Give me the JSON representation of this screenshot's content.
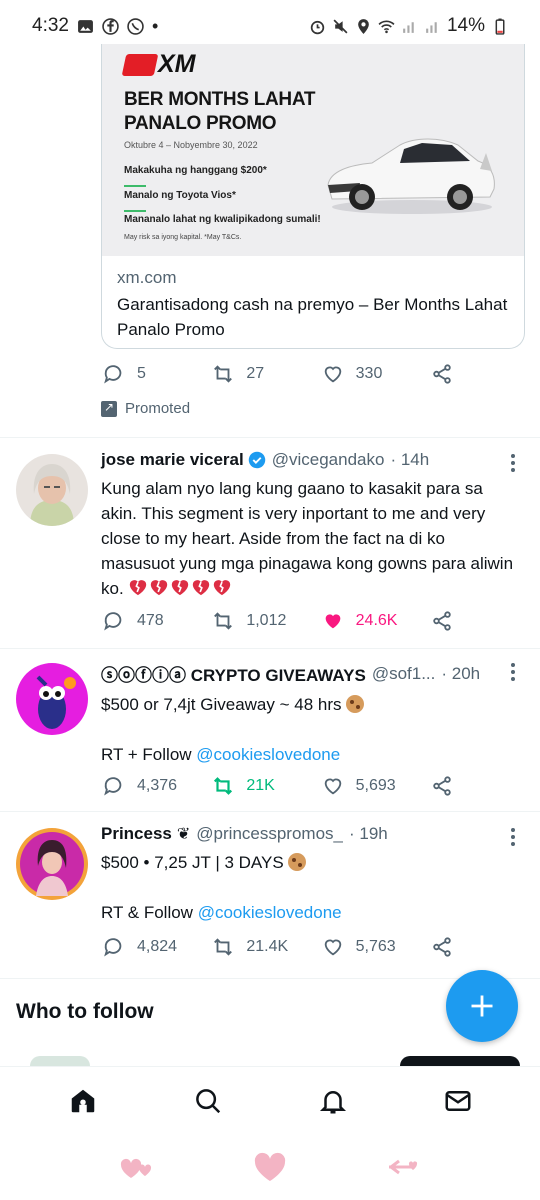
{
  "status_bar": {
    "time": "4:32",
    "battery": "14%"
  },
  "ad": {
    "image": {
      "brand": "XM",
      "title": "BER MONTHS LAHAT PANALO PROMO",
      "dates": "Oktubre 4 – Nobyembre 30, 2022",
      "line1": "Makakuha ng hanggang $200*",
      "line2": "Manalo ng Toyota Vios*",
      "line3": "Mananalo lahat ng kwalipikadong sumali!",
      "fine": "May risk sa iyong kapital. *May T&Cs."
    },
    "domain": "xm.com",
    "headline": "Garantisadong cash na premyo – Ber Months Lahat Panalo Promo",
    "replies": "5",
    "retweets": "27",
    "likes": "330",
    "promoted_label": "Promoted"
  },
  "tweets": [
    {
      "name": "jose marie viceral",
      "handle": "@vicegandako",
      "time": "· 14h",
      "text": "Kung alam nyo lang kung gaano to kasakit para sa akin. This segment is very inportant to me and very close to my heart. Aside from the fact na di ko masusuot yung mga pinagawa kong gowns para aliwin ko.",
      "replies": "478",
      "retweets": "1,012",
      "likes": "24.6K",
      "accent_color": "#f91880"
    },
    {
      "name": "ⓢⓞⓕⓘⓐ CRYPTO GIVEAWAYS",
      "handle": "@sof1...",
      "time": "· 20h",
      "line1": "$500 or 7,4jt Giveaway ~ 48 hrs",
      "line2_prefix": "RT + Follow",
      "line2_link": "@cookieslovedone",
      "replies": "4,376",
      "retweets": "21K",
      "likes": "5,693",
      "accent_color": "#00ba7c"
    },
    {
      "name": "Princess",
      "handle": "@princesspromos_",
      "time": "· 19h",
      "line1": "$500 • 7,25 JT | 3 DAYS",
      "line2_prefix": "RT & Follow",
      "line2_link": "@cookieslovedone",
      "replies": "4,824",
      "retweets": "21.4K",
      "likes": "5,763"
    }
  ],
  "who_to_follow": "Who to follow",
  "nav": [
    "home-icon",
    "search-icon",
    "notifications-icon",
    "messages-icon"
  ],
  "colors": {
    "accent": "#1d9bf0",
    "muted": "#536471",
    "like": "#f91880",
    "retweet": "#00ba7c"
  }
}
